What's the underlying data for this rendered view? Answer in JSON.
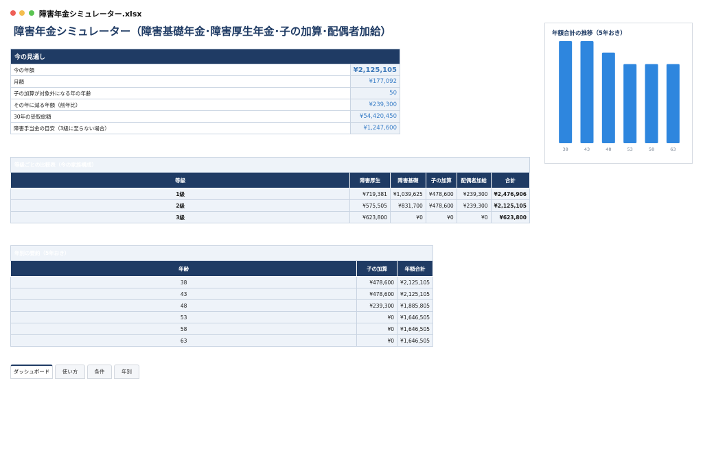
{
  "window": {
    "filename": "障害年金シミュレーター.xlsx"
  },
  "page_title": "障害年金シミュレーター（障害基礎年金･障害厚生年金･子の加算･配偶者加給）",
  "outlook": {
    "title": "今の見通し",
    "rows": [
      {
        "label": "今の年額",
        "value": "¥2,125,105"
      },
      {
        "label": "月額",
        "value": "¥177,092"
      },
      {
        "label": "子の加算が対象外になる年の年齢",
        "value": "50"
      },
      {
        "label": "その年に減る年額（前年比）",
        "value": "¥239,300"
      },
      {
        "label": "30年の受取総額",
        "value": "¥54,420,450"
      },
      {
        "label": "障害手当金の目安（3級に至らない場合）",
        "value": "¥1,247,600"
      }
    ]
  },
  "grade_table": {
    "title": "等級ごとの比較表（今の家族構成）",
    "headers": [
      "等級",
      "障害厚生",
      "障害基礎",
      "子の加算",
      "配偶者加給",
      "合計"
    ],
    "rows": [
      [
        "1級",
        "¥719,381",
        "¥1,039,625",
        "¥478,600",
        "¥239,300",
        "¥2,476,906"
      ],
      [
        "2級",
        "¥575,505",
        "¥831,700",
        "¥478,600",
        "¥239,300",
        "¥2,125,105"
      ],
      [
        "3級",
        "¥623,800",
        "¥0",
        "¥0",
        "¥0",
        "¥623,800"
      ]
    ]
  },
  "yearly_table": {
    "title": "年別の要約（5年おき）",
    "headers": [
      "年齢",
      "子の加算",
      "年額合計"
    ],
    "rows": [
      [
        "38",
        "¥478,600",
        "¥2,125,105"
      ],
      [
        "43",
        "¥478,600",
        "¥2,125,105"
      ],
      [
        "48",
        "¥239,300",
        "¥1,885,805"
      ],
      [
        "53",
        "¥0",
        "¥1,646,505"
      ],
      [
        "58",
        "¥0",
        "¥1,646,505"
      ],
      [
        "63",
        "¥0",
        "¥1,646,505"
      ]
    ]
  },
  "chart_data": {
    "type": "bar",
    "title": "年額合計の推移（5年おき）",
    "categories": [
      "38",
      "43",
      "48",
      "53",
      "58",
      "63"
    ],
    "values": [
      2125105,
      2125105,
      1885805,
      1646505,
      1646505,
      1646505
    ],
    "ylim": [
      0,
      2125105
    ],
    "grid": false,
    "color": "#2e86de"
  },
  "sheet_tabs": [
    {
      "label": "ダッシュボード",
      "active": true
    },
    {
      "label": "使い方",
      "active": false
    },
    {
      "label": "条件",
      "active": false
    },
    {
      "label": "年別",
      "active": false
    }
  ]
}
